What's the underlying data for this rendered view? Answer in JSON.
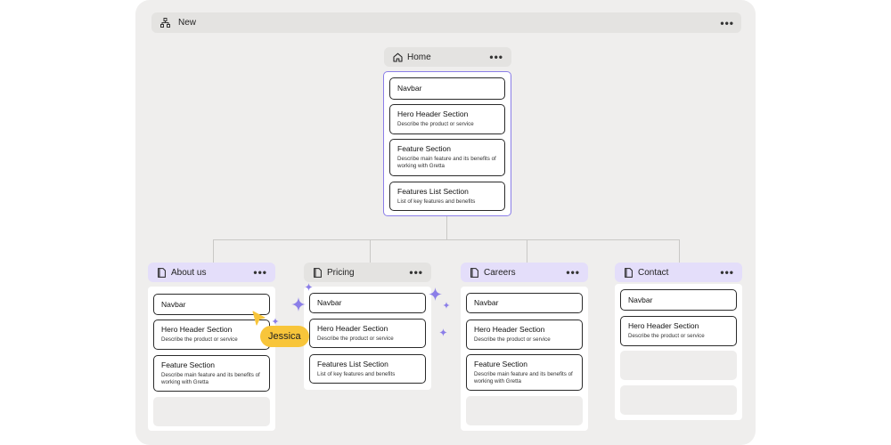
{
  "topbar": {
    "title": "New",
    "menu": "•••",
    "icon": "sitemap-icon"
  },
  "accent_purple": "#8b7ee8",
  "badge_yellow": "#f8c53a",
  "pages": {
    "home": {
      "title": "Home",
      "icon": "home-icon",
      "menu": "•••",
      "sections": [
        {
          "title": "Navbar"
        },
        {
          "title": "Hero Header Section",
          "desc": "Describe the product or service"
        },
        {
          "title": "Feature Section",
          "desc": "Describe main feature and its benefits of working with Gretta"
        },
        {
          "title": "Features List Section",
          "desc": "List of key features and benefits"
        }
      ]
    },
    "about": {
      "title": "About us",
      "icon": "page-icon",
      "menu": "•••",
      "sections": [
        {
          "title": "Navbar"
        },
        {
          "title": "Hero Header Section",
          "desc": "Describe the product or service"
        },
        {
          "title": "Feature Section",
          "desc": "Describe main feature and its benefits of working with Gretta"
        }
      ]
    },
    "pricing": {
      "title": "Pricing",
      "icon": "page-icon",
      "menu": "•••",
      "sections": [
        {
          "title": "Navbar"
        },
        {
          "title": "Hero Header Section",
          "desc": "Describe the product or service"
        },
        {
          "title": "Features List Section",
          "desc": "List of key features and benefits"
        }
      ]
    },
    "careers": {
      "title": "Careers",
      "icon": "page-icon",
      "menu": "•••",
      "sections": [
        {
          "title": "Navbar"
        },
        {
          "title": "Hero Header Section",
          "desc": "Describe the product or service"
        },
        {
          "title": "Feature Section",
          "desc": "Describe main feature and its benefits of working with Gretta"
        }
      ]
    },
    "contact": {
      "title": "Contact",
      "icon": "page-icon",
      "menu": "•••",
      "sections": [
        {
          "title": "Navbar"
        },
        {
          "title": "Hero Header Section",
          "desc": "Describe the product or service"
        }
      ]
    }
  },
  "collaborator": {
    "name": "Jessica",
    "icon": "cursor-icon"
  }
}
